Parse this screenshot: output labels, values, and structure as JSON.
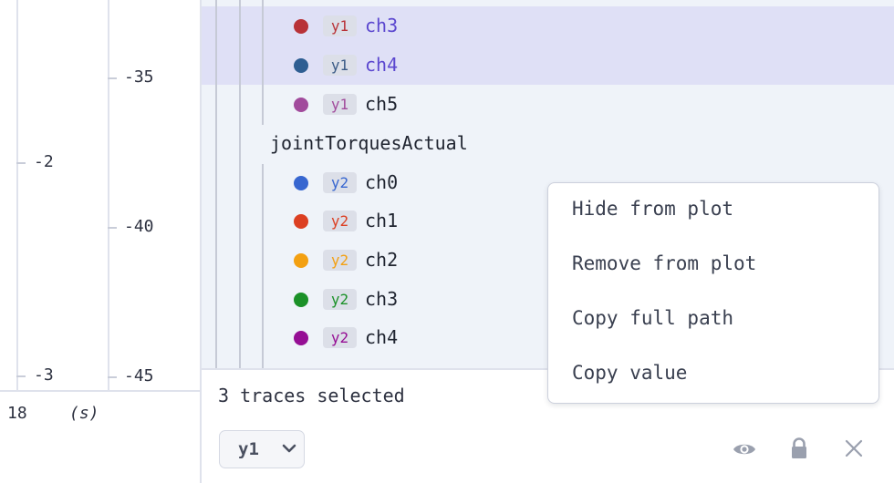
{
  "axes": {
    "left_outer": {
      "ticks": [
        "-2",
        "-3"
      ]
    },
    "left_inner": {
      "ticks": [
        "-35",
        "-40",
        "-45"
      ]
    },
    "x": {
      "tick": "18",
      "unit": "(s)"
    }
  },
  "tree": {
    "rows_top": [
      {
        "axis": "y1",
        "label": "ch3",
        "color": "#b83237",
        "badge_color": "#b83237",
        "selected": true
      },
      {
        "axis": "y1",
        "label": "ch4",
        "color": "#2e5e92",
        "badge_color": "#3a5a86",
        "selected": true
      },
      {
        "axis": "y1",
        "label": "ch5",
        "color": "#a14b9c",
        "badge_color": "#a14b9c",
        "selected": false
      }
    ],
    "group": {
      "label": "jointTorquesActual"
    },
    "rows_bottom": [
      {
        "axis": "y2",
        "label": "ch0",
        "color": "#3766d0",
        "badge_color": "#3766d0"
      },
      {
        "axis": "y2",
        "label": "ch1",
        "color": "#dc3f22",
        "badge_color": "#dc3f22"
      },
      {
        "axis": "y2",
        "label": "ch2",
        "color": "#f3a012",
        "badge_color": "#f3a012"
      },
      {
        "axis": "y2",
        "label": "ch3",
        "color": "#1b9128",
        "badge_color": "#1b9128"
      },
      {
        "axis": "y2",
        "label": "ch4",
        "color": "#950e94",
        "badge_color": "#950e94"
      }
    ]
  },
  "footer": {
    "status": "3 traces selected",
    "axis_select": "y1",
    "icons": [
      "eye-icon",
      "lock-icon",
      "close-icon"
    ]
  },
  "context_menu": {
    "items": [
      "Hide from plot",
      "Remove from plot",
      "Copy full path",
      "Copy value"
    ]
  },
  "colors": {
    "selected_row": "#dfe0f6",
    "panel_bg": "#eff3f9",
    "selected_text": "#5b47cf"
  }
}
